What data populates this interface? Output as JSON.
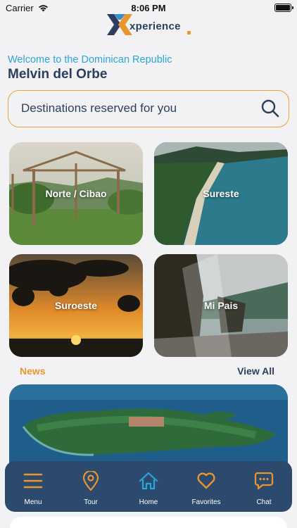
{
  "status_bar": {
    "carrier": "Carrier",
    "time": "8:06 PM"
  },
  "logo": {
    "text": "xperience"
  },
  "header": {
    "welcome": "Welcome to the Dominican Republic",
    "user_name": "Melvin del Orbe"
  },
  "search": {
    "placeholder": "Destinations reserved for you",
    "icon": "search-icon"
  },
  "destinations": [
    {
      "label": "Norte / Cibao"
    },
    {
      "label": "Sureste"
    },
    {
      "label": "Suroeste"
    },
    {
      "label": "Mi Pais"
    }
  ],
  "news": {
    "title": "News",
    "view_all": "View All"
  },
  "tabs": [
    {
      "label": "Menu",
      "icon": "menu-icon",
      "color": "#e8962e"
    },
    {
      "label": "Tour",
      "icon": "location-pin-icon",
      "color": "#e8962e"
    },
    {
      "label": "Home",
      "icon": "home-icon",
      "color": "#2aa6d8",
      "active": true
    },
    {
      "label": "Favorites",
      "icon": "heart-icon",
      "color": "#e8962e"
    },
    {
      "label": "Chat",
      "icon": "chat-icon",
      "color": "#e8962e"
    }
  ],
  "colors": {
    "accent": "#e8962e",
    "primary": "#2b3f5c",
    "link": "#2aa6d8",
    "tab_bar": "#2b4a6e"
  }
}
